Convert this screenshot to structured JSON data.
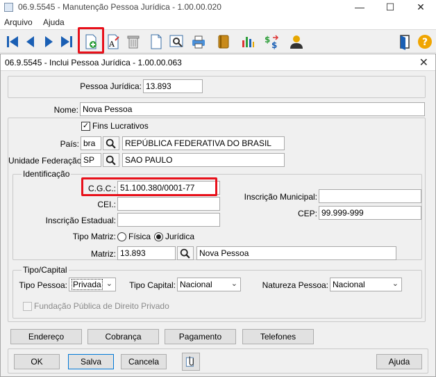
{
  "window": {
    "title": "06.9.5545 - Manutenção Pessoa Jurídica - 1.00.00.020",
    "minimize": "—",
    "maximize": "☐",
    "close": "✕"
  },
  "menu": {
    "items": [
      "Arquivo",
      "Ajuda"
    ]
  },
  "toolbar": {
    "icons": [
      "first-icon",
      "previous-icon",
      "next-icon",
      "last-icon",
      "new-record-icon",
      "edit-icon",
      "delete-icon",
      "document-icon",
      "preview-icon",
      "print-icon",
      "book-icon",
      "chart-icon",
      "currency-icon",
      "user-icon",
      "exit-icon",
      "help-icon"
    ]
  },
  "dialog": {
    "title": "06.9.5545 - Inclui Pessoa Jurídica - 1.00.00.063",
    "close": "✕",
    "pessoa_juridica_label": "Pessoa Jurídica:",
    "pessoa_juridica_value": "13.893",
    "nome_label": "Nome:",
    "nome_value": "Nova Pessoa",
    "fins_lucrativos_label": "Fins Lucrativos",
    "fins_lucrativos_checked": "✓",
    "pais_label": "País:",
    "pais_code": "bra",
    "pais_name": "REPÚBLICA FEDERATIVA DO BRASIL",
    "uf_label": "Unidade Federação:",
    "uf_code": "SP",
    "uf_name": "SAO PAULO",
    "identificacao_legend": "Identificação",
    "cgc_label": "C.G.C.:",
    "cgc_value": "51.100.380/0001-77",
    "cei_label": "CEI.:",
    "cei_value": "",
    "insc_estadual_label": "Inscrição Estadual:",
    "insc_estadual_value": "",
    "insc_municipal_label": "Inscrição Municipal:",
    "insc_municipal_value": "",
    "cep_label": "CEP:",
    "cep_value": "99.999-999",
    "tipo_matriz_label": "Tipo Matriz:",
    "fisica_label": "Física",
    "juridica_label": "Jurídica",
    "matriz_label": "Matriz:",
    "matriz_code": "13.893",
    "matriz_name": "Nova Pessoa",
    "tipo_capital_legend": "Tipo/Capital",
    "tipo_pessoa_label": "Tipo Pessoa:",
    "tipo_pessoa_value": "Privada",
    "tipo_capital_label": "Tipo Capital:",
    "tipo_capital_value": "Nacional",
    "natureza_pessoa_label": "Natureza Pessoa:",
    "natureza_pessoa_value": "Nacional",
    "fundacao_label": "Fundação Pública de Direito Privado",
    "tabs": [
      "Endereço",
      "Cobrança",
      "Pagamento",
      "Telefones"
    ],
    "ok": "OK",
    "salva": "Salva",
    "cancela": "Cancela",
    "ajuda": "Ajuda"
  },
  "colors": {
    "highlight": "#e8111b",
    "accent": "#0078d7"
  }
}
